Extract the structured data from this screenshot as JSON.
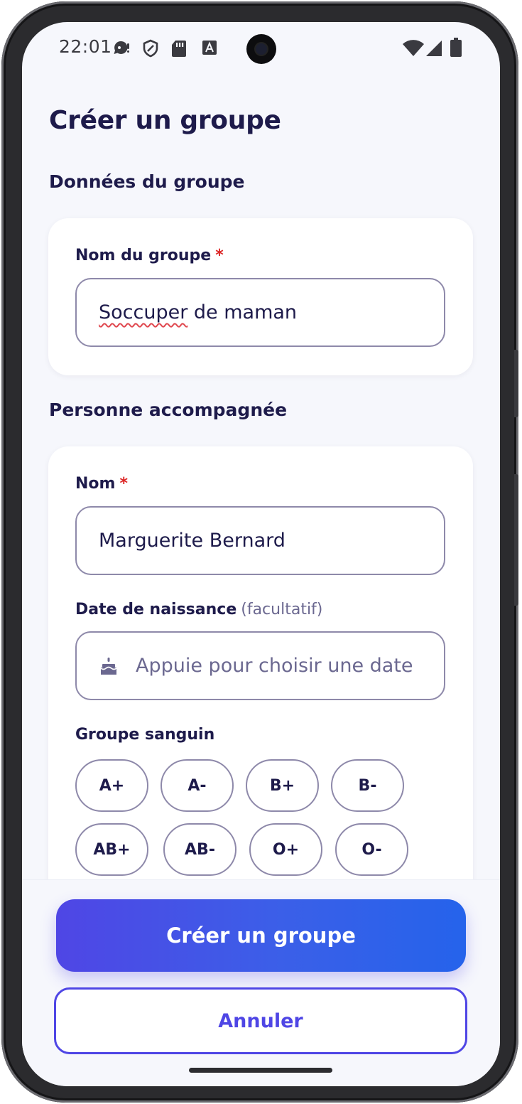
{
  "status_bar": {
    "time": "22:01",
    "left_icons": [
      "chat-bubble-icon",
      "shield-icon",
      "sd-card-icon",
      "keyboard-a-icon"
    ],
    "right_icons": [
      "wifi-icon",
      "cell-signal-icon",
      "battery-icon"
    ]
  },
  "page": {
    "title": "Créer un groupe"
  },
  "group_section": {
    "title": "Données du groupe",
    "name_label": "Nom du groupe",
    "required_mark": "*",
    "name_value_misspelled": "Soccuper",
    "name_value_rest": " de maman"
  },
  "person_section": {
    "title": "Personne accompagnée",
    "name_label": "Nom",
    "required_mark": "*",
    "name_value": "Marguerite Bernard",
    "birthdate_label": "Date de naissance",
    "birthdate_optional": "(facultatif)",
    "birthdate_placeholder": "Appuie pour choisir une date",
    "birthdate_icon": "cake-icon",
    "blood_label": "Groupe sanguin",
    "blood_types": [
      "A+",
      "A-",
      "B+",
      "B-",
      "AB+",
      "AB-",
      "O+",
      "O-"
    ]
  },
  "actions": {
    "create_label": "Créer un groupe",
    "cancel_label": "Annuler"
  },
  "colors": {
    "primary": "#4f46e5",
    "primary_gradient_end": "#2563eb",
    "text_dark": "#1e1b4b",
    "required": "#dc2626",
    "border": "#8e89aa",
    "background": "#f6f7fc"
  }
}
